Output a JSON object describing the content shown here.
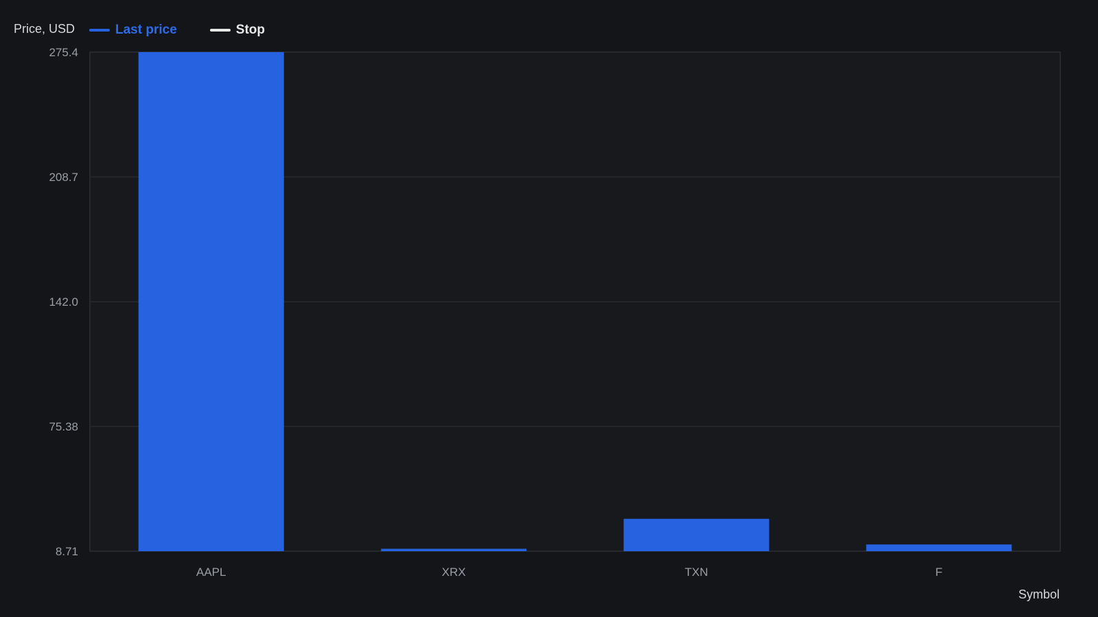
{
  "chart_data": {
    "type": "bar",
    "ylabel": "Price, USD",
    "xlabel": "Symbol",
    "categories": [
      "AAPL",
      "XRX",
      "TXN",
      "F"
    ],
    "series": [
      {
        "name": "Last price",
        "color": "#2563e0",
        "values": [
          275.4,
          10.0,
          26.0,
          12.3
        ]
      },
      {
        "name": "Stop",
        "color": "#e8e8e8",
        "values": []
      }
    ],
    "yticks": [
      "275.4",
      "208.7",
      "142.0",
      "75.38",
      "8.71"
    ],
    "ylim": [
      8.71,
      275.4
    ],
    "grid": true,
    "legend_position": "top-left"
  }
}
